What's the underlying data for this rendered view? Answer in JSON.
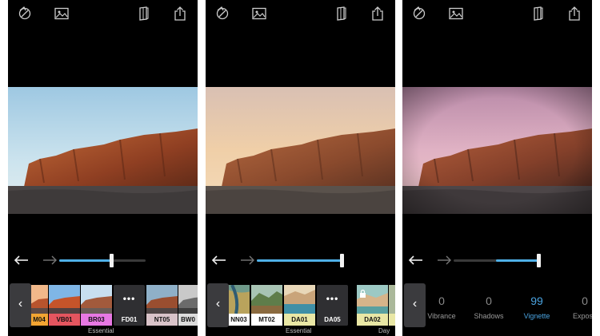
{
  "colors": {
    "accent": "#4fb0e8",
    "panel": "#000000",
    "button": "#3b3b3e"
  },
  "icons": [
    "rotate-icon",
    "image-icon",
    "book-icon",
    "share-icon",
    "undo-icon",
    "redo-icon",
    "chevron-left-icon",
    "lock-icon"
  ],
  "screens": [
    {
      "slider_level": 0.6,
      "filters": [
        {
          "label": "M04",
          "color": "#f2a432"
        },
        {
          "label": "VB01",
          "color": "#e4555f"
        },
        {
          "label": "BR03",
          "color": "#e778e3"
        },
        {
          "label": "FD01",
          "color": "#2f2f32",
          "more": "•••"
        },
        {
          "label": "NT05",
          "color": "#d9c3c9"
        },
        {
          "label": "BW0",
          "color": "#dcdcdc"
        }
      ],
      "group_label": "Essential"
    },
    {
      "slider_level": 0.98,
      "filters": [
        {
          "label": "NN03",
          "color": "#ffffff"
        },
        {
          "label": "MT02",
          "color": "#ffffff"
        },
        {
          "label": "DA01",
          "color": "#e9e7a5"
        },
        {
          "label": "DA05",
          "color": "#2f2f32",
          "more": "•••"
        },
        {
          "label": "DA02",
          "color": "#e9e7a5"
        }
      ],
      "group_label": "Essential",
      "group_label_2": "Day"
    },
    {
      "slider_level": 0.98,
      "adjustments": [
        {
          "value": "0",
          "name": "Vibrance"
        },
        {
          "value": "0",
          "name": "Shadows"
        },
        {
          "value": "99",
          "name": "Vignette",
          "active": true
        },
        {
          "value": "0",
          "name": "Exposu"
        }
      ]
    }
  ]
}
